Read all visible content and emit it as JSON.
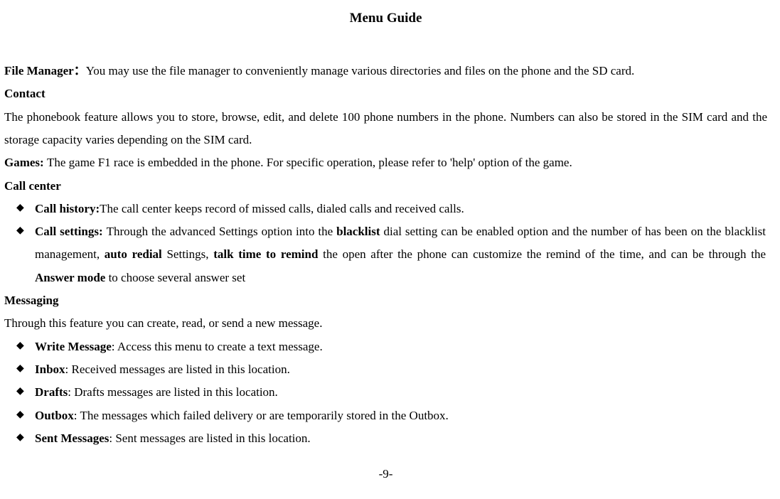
{
  "title": "Menu Guide",
  "sections": {
    "fileManager": {
      "label": "File Manager：",
      "text": "You may use the file manager to conveniently manage various directories and files on the phone and the SD card."
    },
    "contact": {
      "label": "Contact",
      "text": "The phonebook feature allows you to store, browse, edit, and delete 100 phone numbers in the phone. Numbers can also be stored in the SIM card and the storage capacity varies depending on the SIM card."
    },
    "games": {
      "label": "Games: ",
      "text": "The game F1 race is embedded in the phone. For specific operation, please refer to 'help' option of the game."
    },
    "callCenter": {
      "label": "Call center",
      "items": [
        {
          "label": "Call history:",
          "text": "The call center keeps record of missed calls, dialed calls and received calls."
        },
        {
          "label": "Call settings: ",
          "pre": "Through the advanced Settings option into the ",
          "b1": "blacklist",
          "mid1": " dial setting can be enabled option and the number of has been on the blacklist management, ",
          "b2": "auto redial",
          "mid2": " Settings, ",
          "b3": "talk time to remind",
          "mid3": " the open after the phone can customize the remind of the time, and can be through the ",
          "b4": "Answer mode",
          "post": " to choose several answer set"
        }
      ]
    },
    "messaging": {
      "label": "Messaging",
      "text": "Through this feature you can create, read, or send a new message.",
      "items": [
        {
          "label": "Write Message",
          "text": ": Access this menu to create a text message."
        },
        {
          "label": "Inbox",
          "text": ": Received messages are listed in this location."
        },
        {
          "label": "Drafts",
          "text": ": Drafts messages are listed in this location."
        },
        {
          "label": "Outbox",
          "text": ": The messages which failed delivery or are temporarily stored in the Outbox."
        },
        {
          "label": "Sent Messages",
          "text": ": Sent messages are listed in this location."
        }
      ]
    }
  },
  "pageNumber": "-9-"
}
